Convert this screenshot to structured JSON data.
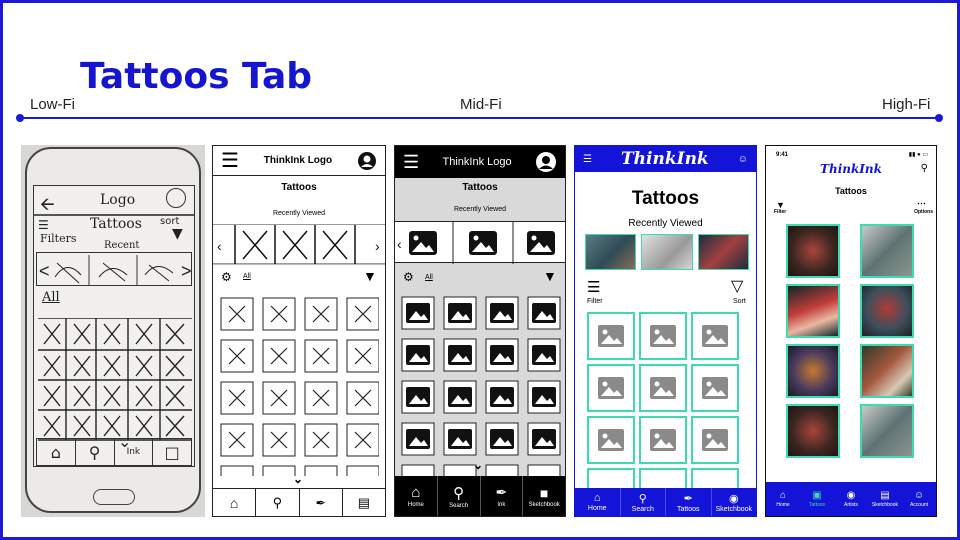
{
  "slide": {
    "title": "Tattoos Tab",
    "stages": {
      "low": "Low-Fi",
      "mid": "Mid-Fi",
      "high": "High-Fi"
    }
  },
  "lowfi": {
    "logo": "Logo",
    "tab": "Tattoos",
    "sort": "sort",
    "filters": "Filters",
    "recent": "Recent",
    "all": "All",
    "nav_ink": "Ink"
  },
  "wire": {
    "logo": "ThinkInk Logo",
    "tab": "Tattoos",
    "recent": "Recently Viewed",
    "all": "All"
  },
  "midfi": {
    "logo": "ThinkInk Logo",
    "tab": "Tattoos",
    "recent": "Recently Viewed",
    "all": "All",
    "nav": [
      "Home",
      "Search",
      "Ink",
      "Sketchbook"
    ]
  },
  "hifi1": {
    "logo": "ThinkInk",
    "tab": "Tattoos",
    "recent": "Recently Viewed",
    "filter": "Filter",
    "sort": "Sort",
    "nav": [
      "Home",
      "Search",
      "Tattoos",
      "Sketchbook"
    ],
    "colors": {
      "brand": "#1414d8",
      "accent": "#3ddcb0"
    }
  },
  "hifi2": {
    "time": "9:41",
    "logo": "ThinkInk",
    "tab": "Tattoos",
    "filter": "Filter",
    "options": "Options",
    "nav": [
      "Home",
      "Tattoos",
      "Artists",
      "Sketchbook",
      "Account"
    ],
    "colors": {
      "brand": "#1414d8",
      "accent": "#3ddcb0"
    }
  }
}
